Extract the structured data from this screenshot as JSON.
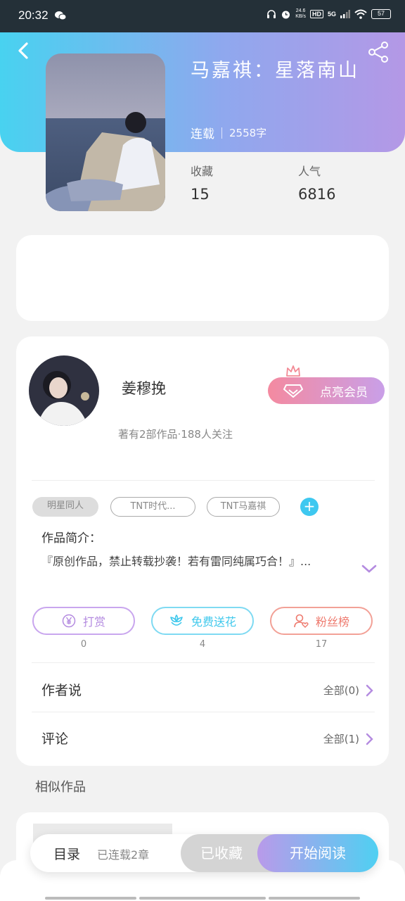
{
  "status_bar": {
    "time": "20:32",
    "speed_value": "24.6",
    "speed_unit": "KB/s",
    "hd": "HD",
    "network": "5G",
    "battery": "57"
  },
  "book": {
    "title": "马嘉祺：星落南山",
    "status": "连载",
    "word_count": "2558字",
    "favorites_label": "收藏",
    "favorites_value": "15",
    "popularity_label": "人气",
    "popularity_value": "6816"
  },
  "author": {
    "name": "姜穆挽",
    "meta": "著有2部作品·188人关注",
    "vip_label": "点亮会员"
  },
  "tags": [
    "明星同人",
    "TNT时代...",
    "TNT马嘉祺"
  ],
  "intro": {
    "label": "作品简介：",
    "text": "『原创作品，禁止转载抄袭！若有雷同纯属巧合！』..."
  },
  "actions": [
    {
      "label": "打赏",
      "count": "0",
      "color": "#b48be0"
    },
    {
      "label": "免费送花",
      "count": "4",
      "color": "#3fc8ec"
    },
    {
      "label": "粉丝榜",
      "count": "17",
      "color": "#ee7a6e"
    }
  ],
  "sections": {
    "author_says": {
      "label": "作者说",
      "link": "全部(0)"
    },
    "comments": {
      "label": "评论",
      "link": "全部(1)"
    }
  },
  "similar": {
    "title": "相似作品"
  },
  "bottom_bar": {
    "toc_label": "目录",
    "toc_count": "已连载2章",
    "fav_label": "已收藏",
    "read_label": "开始阅读"
  }
}
